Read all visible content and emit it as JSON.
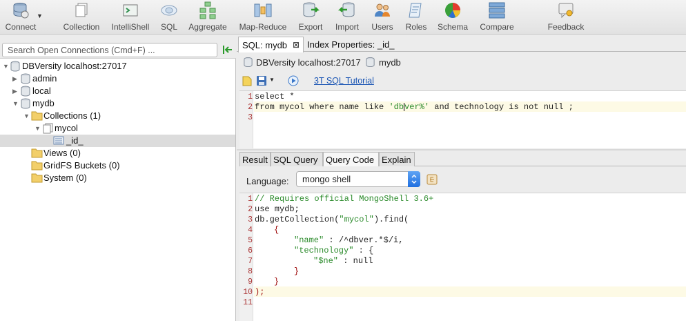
{
  "toolbar": {
    "items": [
      {
        "id": "connect",
        "label": "Connect",
        "icon": "database-connect-icon"
      },
      {
        "id": "collection",
        "label": "Collection",
        "icon": "collection-icon"
      },
      {
        "id": "intellishell",
        "label": "IntelliShell",
        "icon": "shell-icon"
      },
      {
        "id": "sql",
        "label": "SQL",
        "icon": "sql-icon"
      },
      {
        "id": "aggregate",
        "label": "Aggregate",
        "icon": "aggregate-icon"
      },
      {
        "id": "mapreduce",
        "label": "Map-Reduce",
        "icon": "map-reduce-icon"
      },
      {
        "id": "export",
        "label": "Export",
        "icon": "export-icon"
      },
      {
        "id": "import",
        "label": "Import",
        "icon": "import-icon"
      },
      {
        "id": "users",
        "label": "Users",
        "icon": "users-icon"
      },
      {
        "id": "roles",
        "label": "Roles",
        "icon": "roles-icon"
      },
      {
        "id": "schema",
        "label": "Schema",
        "icon": "schema-pie-icon"
      },
      {
        "id": "compare",
        "label": "Compare",
        "icon": "compare-icon"
      },
      {
        "id": "feedback",
        "label": "Feedback",
        "icon": "feedback-icon"
      }
    ]
  },
  "sidebar": {
    "search_placeholder": "Search Open Connections (Cmd+F) ...",
    "tree": {
      "connection": "DBVersity localhost:27017",
      "db_admin": "admin",
      "db_local": "local",
      "db_mydb": "mydb",
      "collections": "Collections (1)",
      "collection_mycol": "mycol",
      "index_id": "_id_",
      "views": "Views (0)",
      "gridfs": "GridFS Buckets (0)",
      "system": "System (0)"
    }
  },
  "tabs": {
    "sql_tab": "SQL: mydb",
    "index_tab": "Index Properties: _id_"
  },
  "connection_bar": {
    "connection": "DBVersity localhost:27017",
    "database": "mydb"
  },
  "sql_toolbar": {
    "tutorial_link": "3T SQL Tutorial"
  },
  "sql_editor": {
    "line_numbers": [
      "1",
      "2",
      "3"
    ],
    "line1": "select *",
    "line2_pre": "from mycol where name like ",
    "line2_str_a": "'db",
    "line2_str_b": "ver%'",
    "line2_post": " and technology is not null ;"
  },
  "result_tabs": {
    "result": "Result",
    "sql_query": "SQL Query",
    "query_code": "Query Code",
    "explain": "Explain"
  },
  "language": {
    "label": "Language:",
    "selected": "mongo shell"
  },
  "query_code": {
    "line_numbers": [
      "1",
      "2",
      "3",
      "4",
      "5",
      "6",
      "7",
      "8",
      "9",
      "10",
      "11"
    ],
    "l1": "// Requires official MongoShell 3.6+",
    "l2": "use mydb;",
    "l3_pre": "db.getCollection(",
    "l3_str": "\"mycol\"",
    "l3_post": ").find(",
    "l4": "{",
    "l5_key": "\"name\"",
    "l5_rest": " : /^dbver.*$/i,",
    "l6_key": "\"technology\"",
    "l6_rest": " : {",
    "l7_key": "\"$ne\"",
    "l7_rest": " : null",
    "l8": "}",
    "l9": "}",
    "l10": ");"
  }
}
